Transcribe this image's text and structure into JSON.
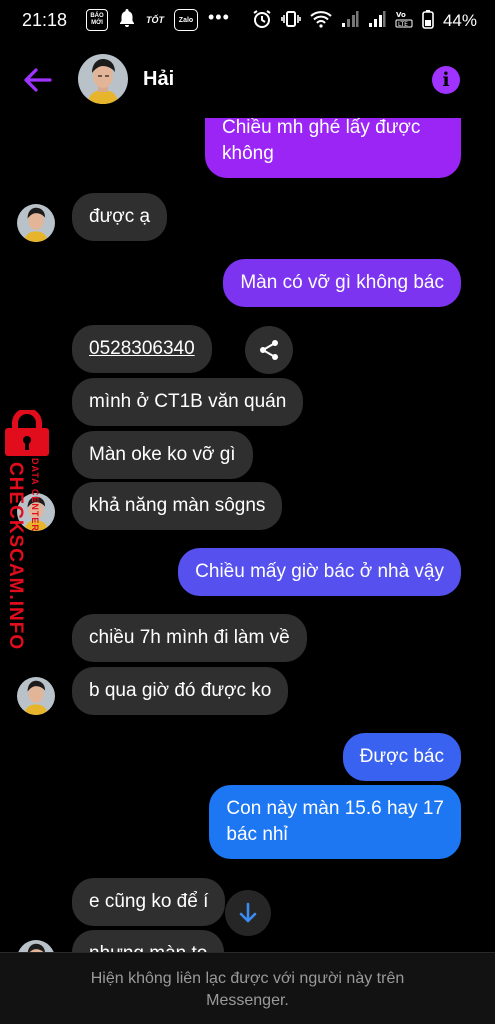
{
  "status_bar": {
    "time": "21:18",
    "app_icon_baomoi": "BÁO MỚI",
    "app_icon_tot": "TỐT",
    "app_icon_zalo": "Zalo",
    "more_dots": "•••",
    "battery": "44%"
  },
  "header": {
    "contact_name": "Hải",
    "accent_color": "#a033ff"
  },
  "messages": [
    {
      "side": "out",
      "text": "Chiều mh ghé lấy được\nkhông"
    },
    {
      "side": "in",
      "text": "được ạ"
    },
    {
      "side": "out",
      "text": "Màn có vỡ gì không bác"
    },
    {
      "side": "in",
      "text": "0528306340"
    },
    {
      "side": "in",
      "text": "mình ở CT1B văn quán"
    },
    {
      "side": "in",
      "text": "Màn oke ko vỡ gì"
    },
    {
      "side": "in",
      "text": "khả năng màn sôgns"
    },
    {
      "side": "out",
      "text": "Chiều mấy giờ bác ở nhà vậy"
    },
    {
      "side": "in",
      "text": "chiều 7h mình đi làm về"
    },
    {
      "side": "in",
      "text": "b qua giờ đó được ko"
    },
    {
      "side": "out",
      "text": "Được bác"
    },
    {
      "side": "out",
      "text": "Con này màn 15.6 hay 17\nbác nhỉ"
    },
    {
      "side": "in",
      "text": "e cũng ko để í"
    },
    {
      "side": "in",
      "text": "nhưng màn to"
    }
  ],
  "watermark": {
    "main": "CHECKSCAM.INFO",
    "small": "DATA CENTER"
  },
  "footer": {
    "notice": "Hiện không liên lạc được với người này trên Messenger."
  }
}
